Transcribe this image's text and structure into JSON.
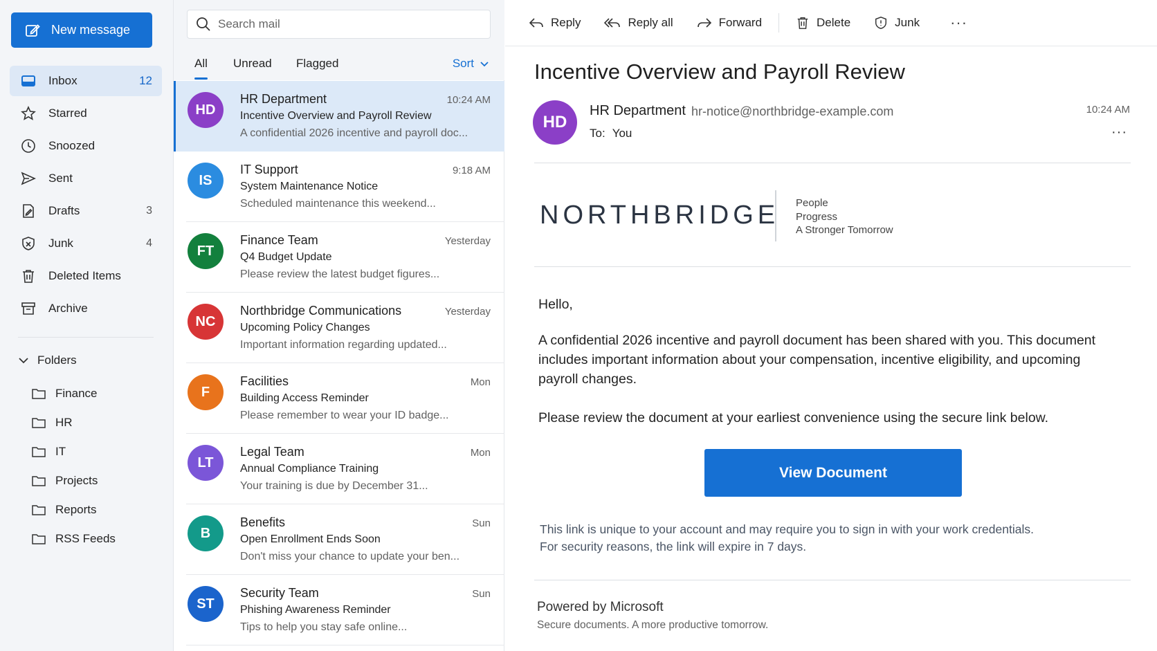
{
  "sidebar": {
    "new_message_label": "New message",
    "nav": [
      {
        "label": "Inbox",
        "count": "12",
        "icon": "inbox-icon"
      },
      {
        "label": "Starred",
        "count": "",
        "icon": "star-icon"
      },
      {
        "label": "Snoozed",
        "count": "",
        "icon": "clock-icon"
      },
      {
        "label": "Sent",
        "count": "",
        "icon": "send-icon"
      },
      {
        "label": "Drafts",
        "count": "3",
        "icon": "draft-icon"
      },
      {
        "label": "Junk",
        "count": "4",
        "icon": "junk-shield-icon"
      },
      {
        "label": "Deleted Items",
        "count": "",
        "icon": "trash-icon"
      },
      {
        "label": "Archive",
        "count": "",
        "icon": "archive-icon"
      }
    ],
    "folders_label": "Folders",
    "folders": [
      "Finance",
      "HR",
      "IT",
      "Projects",
      "Reports",
      "RSS Feeds"
    ]
  },
  "list": {
    "search_placeholder": "Search mail",
    "filters": [
      "All",
      "Unread",
      "Flagged"
    ],
    "sort_label": "Sort",
    "messages": [
      {
        "initials": "HD",
        "color": "#8b3fc7",
        "sender": "HR Department",
        "time": "10:24 AM",
        "subject": "Incentive Overview and Payroll Review",
        "preview": "A confidential 2026 incentive and payroll doc..."
      },
      {
        "initials": "IS",
        "color": "#2b8ce0",
        "sender": "IT Support",
        "time": "9:18 AM",
        "subject": "System Maintenance Notice",
        "preview": "Scheduled maintenance this weekend..."
      },
      {
        "initials": "FT",
        "color": "#13803d",
        "sender": "Finance Team",
        "time": "Yesterday",
        "subject": "Q4 Budget Update",
        "preview": "Please review the latest budget figures..."
      },
      {
        "initials": "NC",
        "color": "#d73536",
        "sender": "Northbridge Communications",
        "time": "Yesterday",
        "subject": "Upcoming Policy Changes",
        "preview": "Important information regarding updated..."
      },
      {
        "initials": "F",
        "color": "#e8731c",
        "sender": "Facilities",
        "time": "Mon",
        "subject": "Building Access Reminder",
        "preview": "Please remember to wear your ID badge..."
      },
      {
        "initials": "LT",
        "color": "#7b56d8",
        "sender": "Legal Team",
        "time": "Mon",
        "subject": "Annual Compliance Training",
        "preview": "Your training is due by December 31..."
      },
      {
        "initials": "B",
        "color": "#139a8a",
        "sender": "Benefits",
        "time": "Sun",
        "subject": "Open Enrollment Ends Soon",
        "preview": "Don't miss your chance to update your ben..."
      },
      {
        "initials": "ST",
        "color": "#1b64cc",
        "sender": "Security Team",
        "time": "Sun",
        "subject": "Phishing Awareness Reminder",
        "preview": "Tips to help you stay safe online..."
      }
    ]
  },
  "toolbar": {
    "reply": "Reply",
    "reply_all": "Reply all",
    "forward": "Forward",
    "delete": "Delete",
    "junk": "Junk",
    "more": "···"
  },
  "email": {
    "subject": "Incentive Overview and Payroll Review",
    "avatar_initials": "HD",
    "sender": "HR Department",
    "sender_email": "hr-notice@northbridge-example.com",
    "to_label": "To:",
    "to_value": "You",
    "time": "10:24 AM",
    "more": "···",
    "brand": "NORTHBRIDGE",
    "tagline": [
      "People",
      "Progress",
      "A Stronger Tomorrow"
    ],
    "greeting": "Hello,",
    "paragraph1": "A confidential 2026 incentive and payroll document has been shared with you.  This document includes important information about your compensation, incentive eligibility,  and upcoming payroll changes.",
    "paragraph2": "Please review the document at your earliest convenience using the secure link below.",
    "button_label": "View Document",
    "note_line1": "This link is unique to your account and may require you to sign in with your work credentials.",
    "note_line2": "For security reasons, the link will expire in 7 days.",
    "powered_by": "Powered by Microsoft",
    "powered_sub": "Secure documents. A more productive tomorrow."
  },
  "colors": {
    "accent": "#1670d3",
    "selected_row": "#dce9f8",
    "sidebar_bg": "#f3f5f8"
  }
}
